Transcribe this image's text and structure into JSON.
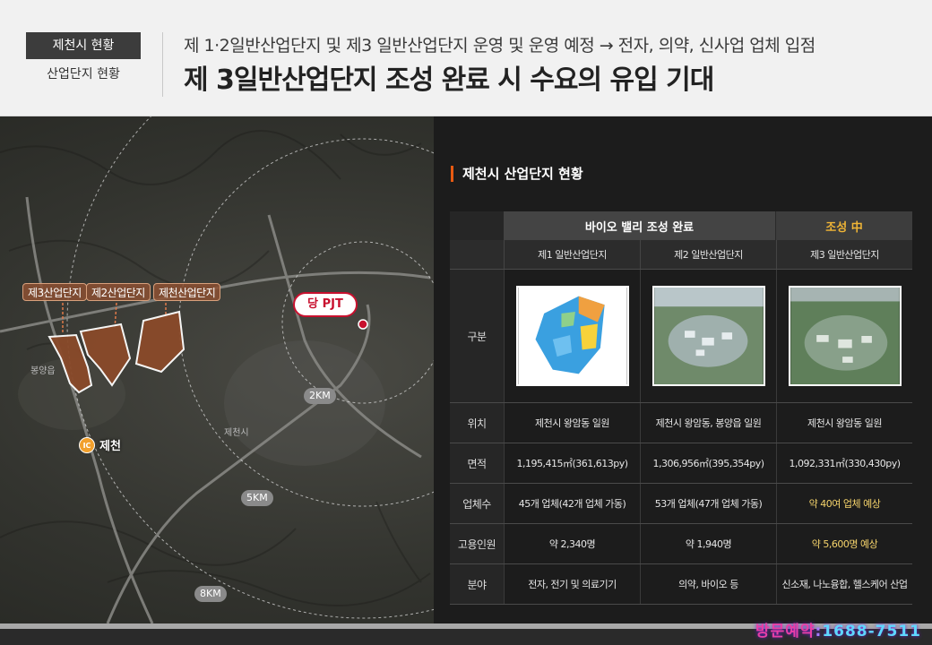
{
  "header": {
    "badge": "제천시 현황",
    "sub_label": "산업단지 현황",
    "line1": "제 1·2일반산업단지 및 제3 일반산업단지 운영 및 운영 예정 → 전자, 의약, 신사업 업체 입점",
    "line2": "제 3일반산업단지 조성 완료 시 수요의 유입 기대"
  },
  "map": {
    "complex_labels": [
      "제3산업단지",
      "제2산업단지",
      "제천산업단지"
    ],
    "pjt_label": "당 PJT",
    "ic_mark": "IC",
    "ic_name": "제천",
    "radius_labels": [
      "2KM",
      "5KM",
      "8KM"
    ],
    "place_labels": [
      "봉양읍",
      "제천시"
    ]
  },
  "panel": {
    "title": "제천시 산업단지 현황",
    "group_bio": "바이오 밸리 조성 완료",
    "group_ing": "조성 中",
    "row_label_header": "구분",
    "columns": [
      "제1 일반산업단지",
      "제2 일반산업단지",
      "제3 일반산업단지"
    ],
    "rows": [
      {
        "label": "위치",
        "values": [
          "제천시 왕암동 일원",
          "제천시 왕암동, 봉양읍 일원",
          "제천시 왕암동 일원"
        ]
      },
      {
        "label": "면적",
        "values": [
          "1,195,415㎡(361,613py)",
          "1,306,956㎡(395,354py)",
          "1,092,331㎡(330,430py)"
        ]
      },
      {
        "label": "업체수",
        "values": [
          "45개 업체(42개 업체 가동)",
          "53개 업체(47개 업체 가동)",
          "약 40여 업체 예상"
        ]
      },
      {
        "label": "고용인원",
        "values": [
          "약 2,340명",
          "약 1,940명",
          "약 5,600명 예상"
        ]
      },
      {
        "label": "분야",
        "values": [
          "전자, 전기 및 의료기기",
          "의약, 바이오 등",
          "신소재, 나노융합, 헬스케어 산업"
        ]
      }
    ]
  },
  "footer": {
    "visit_a": "방문예약",
    "visit_b": ":",
    "visit_c": "1688-7511"
  }
}
